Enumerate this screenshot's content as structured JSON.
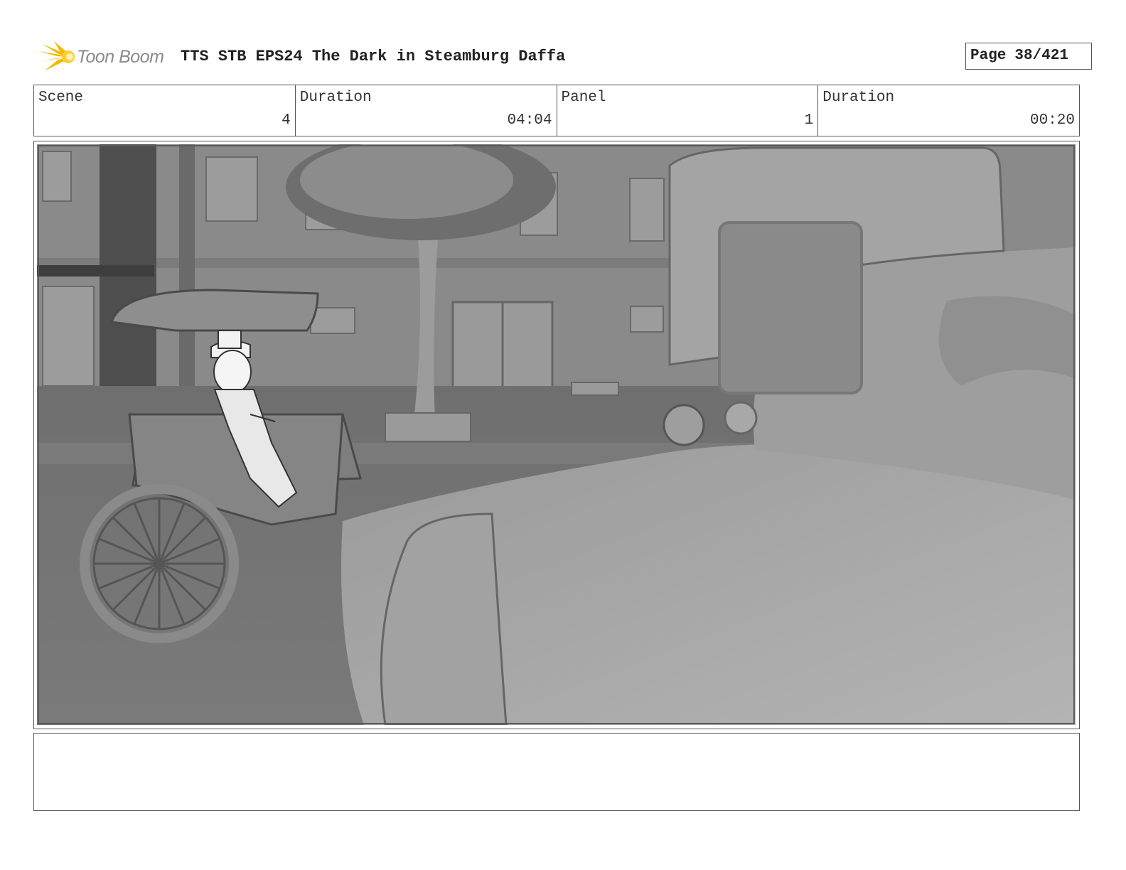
{
  "header": {
    "logo_text": "Toon Boom",
    "title": "TTS STB EPS24 The Dark in Steamburg Daffa",
    "page_label": "Page",
    "page_number": "38/421"
  },
  "info": {
    "scene_label": "Scene",
    "scene_value": "4",
    "scene_duration_label": "Duration",
    "scene_duration_value": "04:04",
    "panel_label": "Panel",
    "panel_value": "1",
    "panel_duration_label": "Duration",
    "panel_duration_value": "00:20"
  },
  "panel": {
    "description": ""
  },
  "notes": {
    "text": ""
  },
  "colors": {
    "logo_accent": "#f5b800",
    "border": "#555555"
  },
  "icons": {
    "logo": "toon-boom-burst-icon"
  }
}
